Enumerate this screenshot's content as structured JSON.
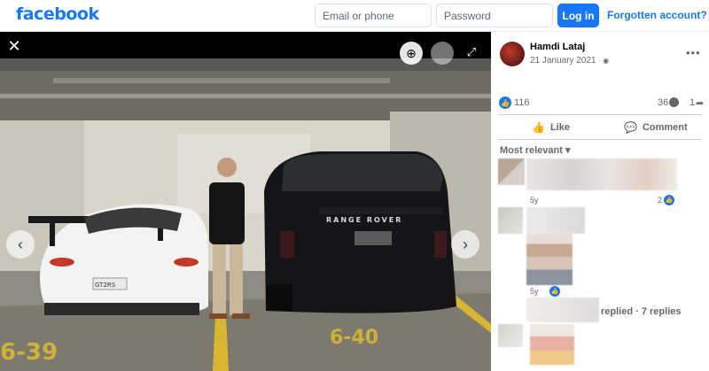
{
  "header": {
    "logo": "facebook",
    "email_placeholder": "Email or phone",
    "password_placeholder": "Password",
    "login_label": "Log in",
    "forgot_label": "Forgotten account?"
  },
  "viewer": {
    "close_icon": "close-icon",
    "zoom_in_icon": "zoom-in-icon",
    "zoom_out_icon": "zoom-out-icon",
    "expand_icon": "expand-icon",
    "prev_icon": "chevron-left-icon",
    "next_icon": "chevron-right-icon",
    "photo": {
      "car_left_plate": "GT2RS",
      "car_right_brand": "RANGE ROVER",
      "floor_text_left": "6-39",
      "floor_text_right": "6-40"
    }
  },
  "post": {
    "author": "Hamdi Lataj",
    "date": "21 January 2021",
    "reactions_count": "116",
    "comments_count": "36",
    "shares_count": "1",
    "like_label": "Like",
    "comment_label": "Comment",
    "sort_label": "Most relevant"
  },
  "comments": [
    {
      "time": "5y",
      "reactions": "2"
    },
    {
      "time": "5y",
      "reactions": ""
    },
    {
      "replies_label": "replied · 7 replies"
    }
  ],
  "colors": {
    "brand": "#1877f2",
    "secondary_text": "#65676b",
    "viewer_bg": "#000000"
  }
}
